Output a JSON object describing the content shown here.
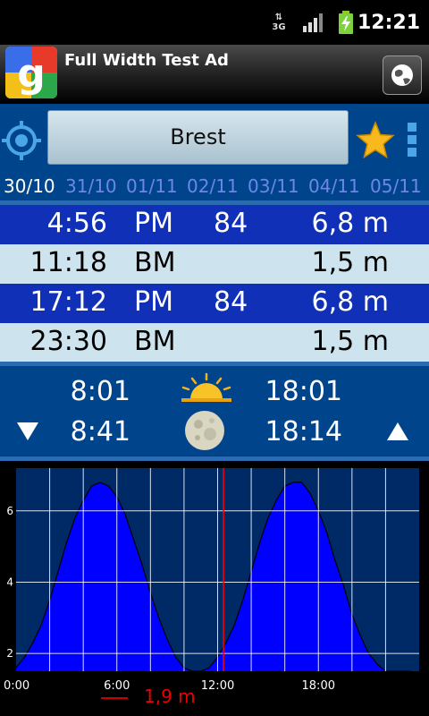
{
  "status": {
    "network": "3G",
    "time": "12:21"
  },
  "ad": {
    "title": "Full Width Test Ad"
  },
  "header": {
    "city": "Brest"
  },
  "dates": [
    "30/10",
    "31/10",
    "01/11",
    "02/11",
    "03/11",
    "04/11",
    "05/11"
  ],
  "tides": [
    {
      "time": "4:56",
      "type": "PM",
      "coef": "84",
      "height": "6,8 m"
    },
    {
      "time": "11:18",
      "type": "BM",
      "coef": "",
      "height": "1,5 m"
    },
    {
      "time": "17:12",
      "type": "PM",
      "coef": "84",
      "height": "6,8 m"
    },
    {
      "time": "23:30",
      "type": "BM",
      "coef": "",
      "height": "1,5 m"
    }
  ],
  "sun": {
    "rise": "8:01",
    "set": "18:01"
  },
  "moon": {
    "rise": "8:41",
    "set": "18:14"
  },
  "chart": {
    "cursor_label": "1,9 m"
  },
  "chart_data": {
    "type": "area",
    "x": [
      0,
      0.5,
      1,
      1.5,
      2,
      2.5,
      3,
      3.5,
      4,
      4.5,
      5,
      5.5,
      6,
      6.5,
      7,
      7.5,
      8,
      8.5,
      9,
      9.5,
      10,
      10.5,
      11,
      11.5,
      12,
      12.5,
      13,
      13.5,
      14,
      14.5,
      15,
      15.5,
      16,
      16.5,
      17,
      17.5,
      18,
      18.5,
      19,
      19.5,
      20,
      20.5,
      21,
      21.5,
      22,
      22.5,
      23,
      23.5
    ],
    "y": [
      1.6,
      1.9,
      2.3,
      2.8,
      3.5,
      4.3,
      5.1,
      5.8,
      6.3,
      6.7,
      6.8,
      6.7,
      6.4,
      5.9,
      5.2,
      4.5,
      3.7,
      3.0,
      2.4,
      1.9,
      1.6,
      1.5,
      1.5,
      1.6,
      1.9,
      2.3,
      2.8,
      3.5,
      4.3,
      5.1,
      5.8,
      6.3,
      6.7,
      6.8,
      6.8,
      6.5,
      6.0,
      5.4,
      4.6,
      3.9,
      3.1,
      2.5,
      2.0,
      1.7,
      1.5,
      1.5,
      1.5,
      1.5
    ],
    "xticks": [
      "0:00",
      "6:00",
      "12:00",
      "18:00"
    ],
    "yticks": [
      "2",
      "4",
      "6"
    ],
    "xlim": [
      0,
      24
    ],
    "ylim": [
      1.5,
      7.2
    ],
    "cursor_x": 12.35,
    "fill_color": "#0000ff",
    "background_color": "#002a66",
    "cursor_color": "#ff0000",
    "grid": true
  }
}
